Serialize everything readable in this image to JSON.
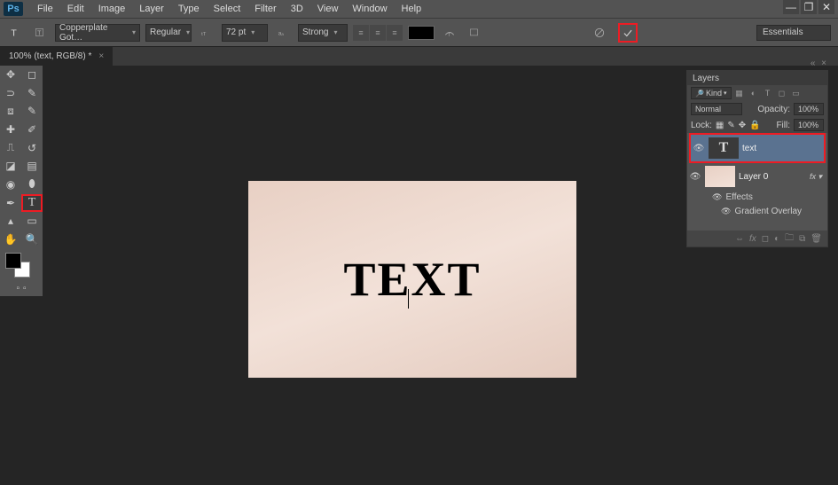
{
  "app": {
    "logo": "Ps"
  },
  "menu": {
    "items": [
      "File",
      "Edit",
      "Image",
      "Layer",
      "Type",
      "Select",
      "Filter",
      "3D",
      "View",
      "Window",
      "Help"
    ]
  },
  "options": {
    "font_family": "Copperplate Got…",
    "font_style": "Regular",
    "font_size": "72 pt",
    "antialias": "Strong",
    "workspace": "Essentials"
  },
  "document": {
    "tab_label": "100% (text, RGB/8) *",
    "canvas_text": "TEXT"
  },
  "layers_panel": {
    "title": "Layers",
    "filter_kind": "Kind",
    "blend_mode": "Normal",
    "opacity_label": "Opacity:",
    "opacity_value": "100%",
    "lock_label": "Lock:",
    "fill_label": "Fill:",
    "fill_value": "100%",
    "layers": [
      {
        "name": "text",
        "type": "text",
        "selected": true
      },
      {
        "name": "Layer 0",
        "type": "raster",
        "selected": false
      }
    ],
    "effects_label": "Effects",
    "effect_item": "Gradient Overlay"
  }
}
